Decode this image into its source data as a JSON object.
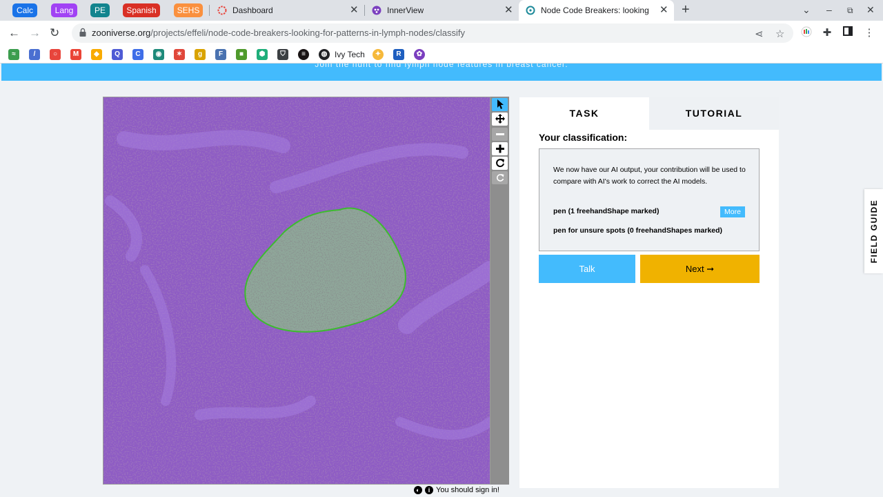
{
  "browser": {
    "tab_groups": [
      {
        "label": "Calc",
        "color": "#1a73e8"
      },
      {
        "label": "Lang",
        "color": "#a142f4"
      },
      {
        "label": "PE",
        "color": "#12848e"
      },
      {
        "label": "Spanish",
        "color": "#d93025"
      },
      {
        "label": "SEHS",
        "color": "#fa903e"
      }
    ],
    "tabs": [
      {
        "title": "Dashboard",
        "icon": "dashboard-favicon"
      },
      {
        "title": "InnerView",
        "icon": "innerview-favicon"
      },
      {
        "title": "Node Code Breakers: looking for",
        "icon": "zooniverse-favicon",
        "active": true
      }
    ],
    "new_tab_label": "+",
    "url_host": "zooniverse.org",
    "url_path": "/projects/effeli/node-code-breakers-looking-for-patterns-in-lymph-nodes/classify",
    "bookmark_named": "Ivy Tech",
    "bookmarks": [
      {
        "icon": "wave-icon",
        "color": "#3c9d4e",
        "glyph": "≈"
      },
      {
        "icon": "stats-icon",
        "color": "#4a6fd1",
        "glyph": "/"
      },
      {
        "icon": "ring-icon",
        "color": "#e8453c",
        "glyph": "○"
      },
      {
        "icon": "gmail-icon",
        "color": "#ea4335",
        "glyph": "M"
      },
      {
        "icon": "drop-icon",
        "color": "#f9ab00",
        "glyph": "◆"
      },
      {
        "icon": "q-icon",
        "color": "#4f5bd5",
        "glyph": "Q"
      },
      {
        "icon": "c-icon",
        "color": "#3f6ee8",
        "glyph": "C"
      },
      {
        "icon": "globe-icon",
        "color": "#1e8a7a",
        "glyph": "◉"
      },
      {
        "icon": "star-icon",
        "color": "#e0473a",
        "glyph": "✶"
      },
      {
        "icon": "g-icon",
        "color": "#d9a300",
        "glyph": "g"
      },
      {
        "icon": "f-icon",
        "color": "#4a72b0",
        "glyph": "F"
      },
      {
        "icon": "green-icon",
        "color": "#4f9a2c",
        "glyph": "■"
      },
      {
        "icon": "hex-icon",
        "color": "#1fae7a",
        "glyph": "⬢"
      },
      {
        "icon": "shield-icon",
        "color": "#3c4043",
        "glyph": "⛉"
      },
      {
        "icon": "spotify-icon",
        "color": "#191414",
        "glyph": "≡"
      }
    ],
    "bookmarks_tail": [
      {
        "icon": "lightbulb-icon",
        "color": "#f6b93b",
        "glyph": "✦"
      },
      {
        "icon": "r-icon",
        "color": "#1f5fbf",
        "glyph": "R"
      },
      {
        "icon": "innerview-icon",
        "color": "#7b3fbf",
        "glyph": "✿"
      }
    ]
  },
  "page": {
    "banner_text": "Join the hunt to find lymph node features in breast cancer.",
    "tabs": {
      "task": "TASK",
      "tutorial": "TUTORIAL"
    },
    "classification_heading": "Your classification:",
    "task_description": "We now have our AI output, your contribution will be used to compare with AI's work to correct the AI models.",
    "tools": [
      {
        "label": "pen (1 freehandShape marked)",
        "more": "More"
      },
      {
        "label": "pen for unsure spots (0 freehandShapes marked)"
      }
    ],
    "talk_label": "Talk",
    "next_label": "Next ➞",
    "field_guide_label": "FIELD GUIDE",
    "footer_text": "You should sign in!",
    "colors": {
      "accent": "#43bbfd",
      "next": "#f0b200",
      "marking": "#3dbb2f"
    }
  },
  "viewer_tools": [
    {
      "name": "pointer-tool",
      "glyph": "pointer",
      "active": true
    },
    {
      "name": "pan-tool",
      "glyph": "move"
    },
    {
      "name": "zoom-out-tool",
      "glyph": "minus"
    },
    {
      "name": "zoom-in-tool",
      "glyph": "plus"
    },
    {
      "name": "rotate-tool",
      "glyph": "rotate"
    },
    {
      "name": "reset-tool",
      "glyph": "reset",
      "disabled": true
    }
  ]
}
